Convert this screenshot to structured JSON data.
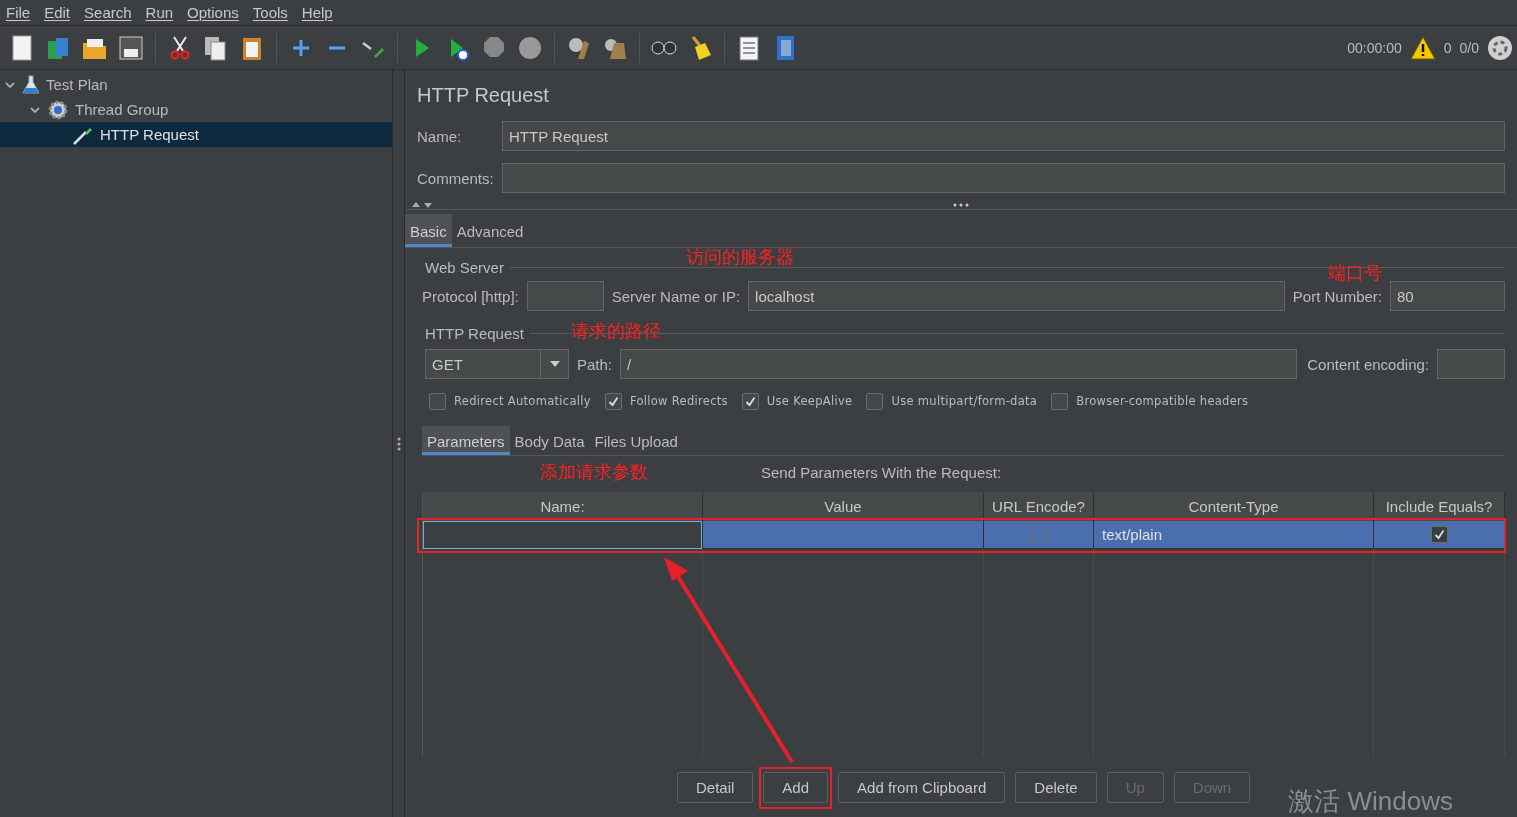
{
  "menu": [
    "File",
    "Edit",
    "Search",
    "Run",
    "Options",
    "Tools",
    "Help"
  ],
  "status": {
    "timer": "00:00:00",
    "warnings": "0",
    "threads": "0/0"
  },
  "tree": [
    {
      "label": "Test Plan",
      "kind": "plan",
      "expanded": true,
      "selected": false,
      "children": [
        {
          "label": "Thread Group",
          "kind": "group",
          "expanded": true,
          "selected": false,
          "children": [
            {
              "label": "HTTP Request",
              "kind": "sampler",
              "selected": true
            }
          ]
        }
      ]
    }
  ],
  "title": "HTTP Request",
  "name_field": {
    "label": "Name:",
    "value": "HTTP Request"
  },
  "comments_field": {
    "label": "Comments:"
  },
  "tabs": [
    {
      "label": "Basic",
      "selected": true
    },
    {
      "label": "Advanced",
      "selected": false
    }
  ],
  "web_server": {
    "legend": "Web Server",
    "protocol_label": "Protocol [http]:",
    "server_label": "Server Name or IP:",
    "server_value": "localhost",
    "port_label": "Port Number:",
    "port_value": "80"
  },
  "http_request": {
    "legend": "HTTP Request",
    "method": "GET",
    "path_label": "Path:",
    "path_value": "/",
    "encoding_label": "Content encoding:"
  },
  "options": [
    {
      "label": "Redirect Automatically",
      "checked": false
    },
    {
      "label": "Follow Redirects",
      "checked": true
    },
    {
      "label": "Use KeepAlive",
      "checked": true
    },
    {
      "label": "Use multipart/form-data",
      "checked": false
    },
    {
      "label": "Browser-compatible headers",
      "checked": false
    }
  ],
  "param_tabs": [
    {
      "label": "Parameters",
      "selected": true
    },
    {
      "label": "Body Data",
      "selected": false
    },
    {
      "label": "Files Upload",
      "selected": false
    }
  ],
  "table": {
    "caption": "Send Parameters With the Request:",
    "columns": [
      "Name:",
      "Value",
      "URL Encode?",
      "Content-Type",
      "Include Equals?"
    ],
    "rows": [
      {
        "selected": true,
        "highlighted": true,
        "url_encode": false,
        "content_type": "text/plain",
        "include_equals": true
      }
    ]
  },
  "buttons": [
    {
      "label": "Detail",
      "disabled": false,
      "highlighted": false
    },
    {
      "label": "Add",
      "disabled": false,
      "highlighted": true
    },
    {
      "label": "Add from Clipboard",
      "disabled": false,
      "highlighted": false
    },
    {
      "label": "Delete",
      "disabled": false,
      "highlighted": false
    },
    {
      "label": "Up",
      "disabled": true,
      "highlighted": false
    },
    {
      "label": "Down",
      "disabled": true,
      "highlighted": false
    }
  ],
  "annotations": [
    "访问的服务器",
    "端口号",
    "请求的路径",
    "添加请求参数"
  ],
  "os_notice": "激活 Windows"
}
